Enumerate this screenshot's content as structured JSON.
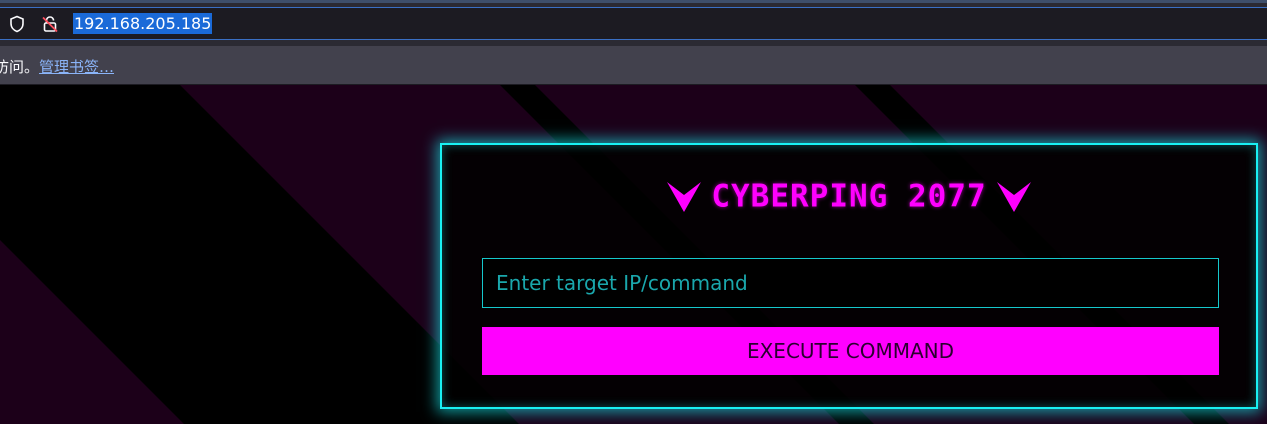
{
  "browser": {
    "url": "192.168.205.185",
    "bookmarks_bar": {
      "prefix_text": "访问。",
      "manage_link": "管理书签…"
    }
  },
  "app": {
    "title": "CYBERPING 2077",
    "input": {
      "placeholder": "Enter target IP/command",
      "value": ""
    },
    "execute_button": "EXECUTE COMMAND"
  },
  "colors": {
    "accent_magenta": "#ff00ff",
    "accent_cyan": "#19f0f2",
    "stripe_purple": "#1c0019"
  },
  "icons": {
    "title_left": "chevron-down-icon",
    "title_right": "chevron-down-icon",
    "urlbar_shield": "shield-icon",
    "urlbar_lock": "lock-insecure-icon"
  }
}
